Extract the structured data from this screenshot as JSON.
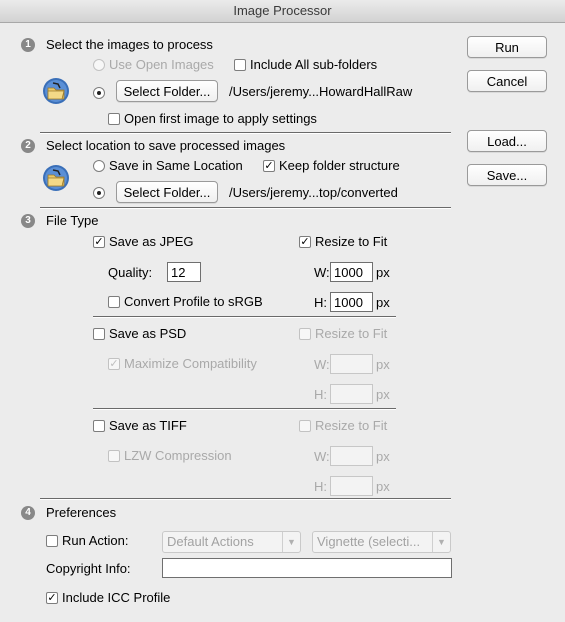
{
  "window": {
    "title": "Image Processor"
  },
  "buttons": {
    "run": "Run",
    "cancel": "Cancel",
    "load": "Load...",
    "save": "Save..."
  },
  "section1": {
    "number": "1",
    "heading": "Select the images to process",
    "use_open_images": "Use Open Images",
    "include_subfolders": "Include All sub-folders",
    "select_folder": "Select Folder...",
    "folder_path": "/Users/jeremy...HowardHallRaw",
    "open_first_image": "Open first image to apply settings"
  },
  "section2": {
    "number": "2",
    "heading": "Select location to save processed images",
    "save_same_location": "Save in Same Location",
    "keep_folder_structure": "Keep folder structure",
    "select_folder": "Select Folder...",
    "folder_path": "/Users/jeremy...top/converted"
  },
  "section3": {
    "number": "3",
    "heading": "File Type",
    "jpeg": {
      "save_as": "Save as JPEG",
      "resize": "Resize to Fit",
      "quality_label": "Quality:",
      "quality_value": "12",
      "w_label": "W:",
      "w_value": "1000",
      "w_unit": "px",
      "h_label": "H:",
      "h_value": "1000",
      "h_unit": "px",
      "convert_profile": "Convert Profile to sRGB"
    },
    "psd": {
      "save_as": "Save as PSD",
      "resize": "Resize to Fit",
      "maximize": "Maximize Compatibility",
      "w_label": "W:",
      "w_unit": "px",
      "h_label": "H:",
      "h_unit": "px"
    },
    "tiff": {
      "save_as": "Save as TIFF",
      "resize": "Resize to Fit",
      "lzw": "LZW Compression",
      "w_label": "W:",
      "w_unit": "px",
      "h_label": "H:",
      "h_unit": "px"
    }
  },
  "section4": {
    "number": "4",
    "heading": "Preferences",
    "run_action": "Run Action:",
    "action_set": "Default Actions",
    "action_name": "Vignette (selecti...",
    "copyright_label": "Copyright Info:",
    "copyright_value": "",
    "include_icc": "Include ICC Profile"
  },
  "state": {
    "include_subfolders": false,
    "open_first_image": false,
    "keep_folder_structure": true,
    "save_jpeg": true,
    "jpeg_resize": true,
    "convert_profile": false,
    "save_psd": false,
    "psd_resize": false,
    "maximize_compat": true,
    "save_tiff": false,
    "tiff_resize": false,
    "lzw": false,
    "run_action": false,
    "include_icc": true
  }
}
